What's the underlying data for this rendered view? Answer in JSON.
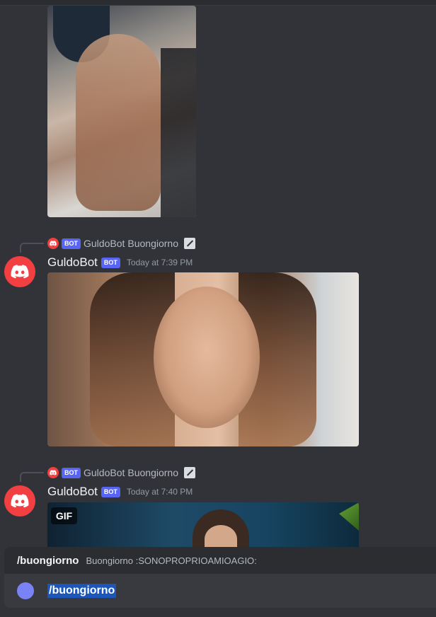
{
  "messages": [
    {
      "reply": {
        "tag": "BOT",
        "author": "GuldoBot",
        "text": "Buongiorno"
      },
      "author": "GuldoBot",
      "tag": "BOT",
      "timestamp": "Today at 7:39 PM"
    },
    {
      "reply": {
        "tag": "BOT",
        "author": "GuldoBot",
        "text": "Buongiorno"
      },
      "author": "GuldoBot",
      "tag": "BOT",
      "timestamp": "Today at 7:40 PM",
      "attachment_badge": "GIF"
    }
  ],
  "autocomplete": {
    "command": "/buongiorno",
    "description": "Buongiorno :SONOPROPRIOAMIOAGIO:"
  },
  "input": {
    "value": "/buongiorno"
  },
  "colors": {
    "background": "#313338",
    "bot_tag": "#5865f2",
    "avatar": "#f23f42",
    "selection": "#1c56b8"
  },
  "icons": [
    "discord-logo-icon",
    "edit-icon",
    "attach-icon"
  ]
}
